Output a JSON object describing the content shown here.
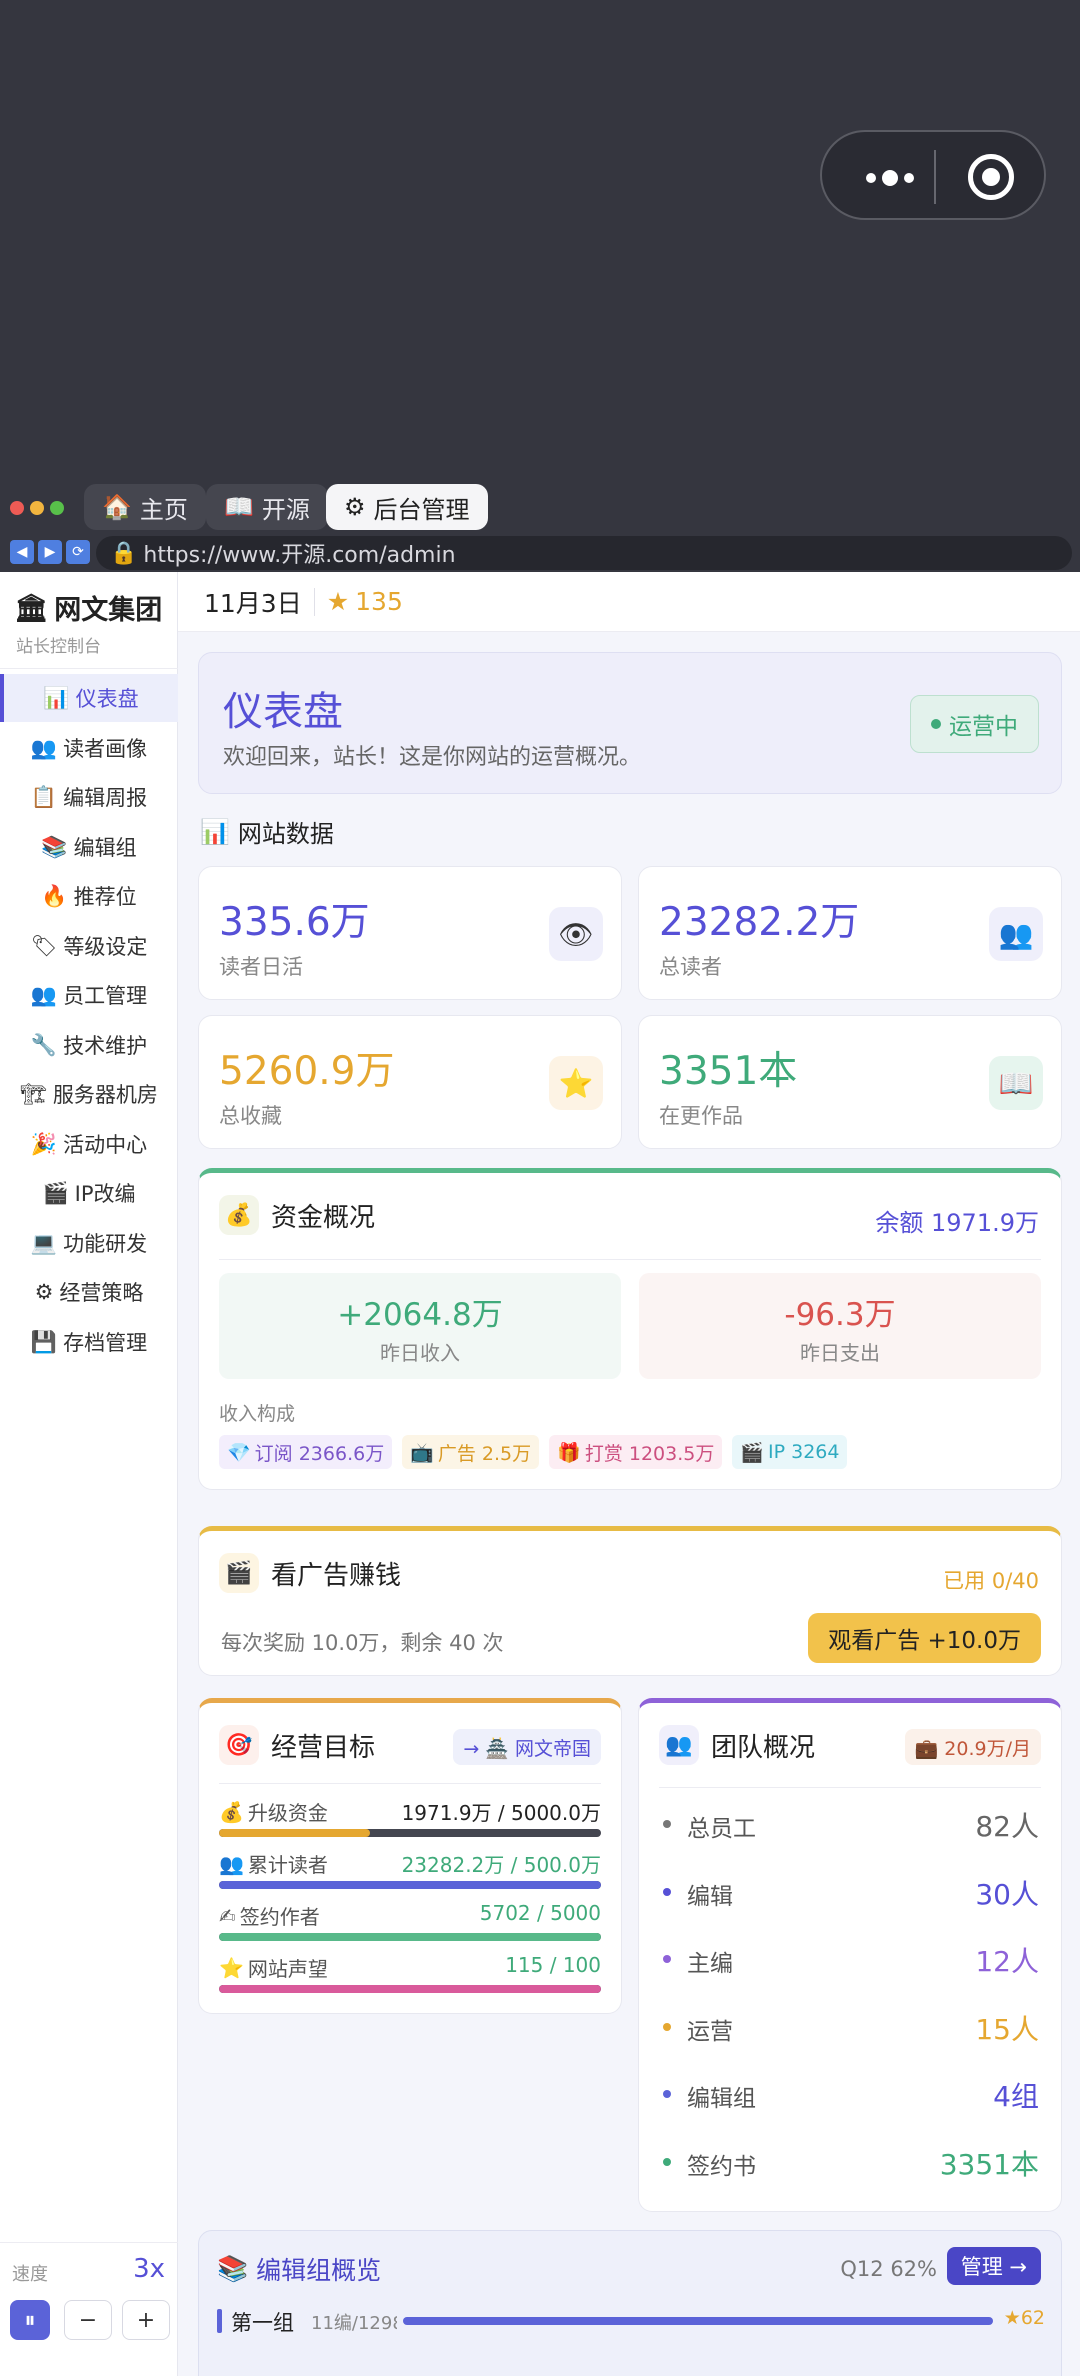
{
  "browser": {
    "tabs": [
      {
        "icon": "🏠",
        "label": "主页"
      },
      {
        "icon": "📖",
        "label": "开源"
      },
      {
        "icon": "⚙",
        "label": "后台管理"
      }
    ],
    "url": "https://www.开源.com/admin"
  },
  "sidebar": {
    "brand": "网文集团",
    "brand_icon": "🏛",
    "subtitle": "站长控制台",
    "items": [
      {
        "icon": "📊",
        "label": "仪表盘"
      },
      {
        "icon": "👥",
        "label": "读者画像"
      },
      {
        "icon": "📋",
        "label": "编辑周报"
      },
      {
        "icon": "📚",
        "label": "编辑组"
      },
      {
        "icon": "🔥",
        "label": "推荐位"
      },
      {
        "icon": "🏷",
        "label": "等级设定"
      },
      {
        "icon": "👥",
        "label": "员工管理"
      },
      {
        "icon": "🔧",
        "label": "技术维护"
      },
      {
        "icon": "🏗",
        "label": "服务器机房"
      },
      {
        "icon": "🎉",
        "label": "活动中心"
      },
      {
        "icon": "🎬",
        "label": "IP改编"
      },
      {
        "icon": "💻",
        "label": "功能研发"
      },
      {
        "icon": "⚙",
        "label": "经营策略"
      },
      {
        "icon": "💾",
        "label": "存档管理"
      }
    ],
    "speed_label": "速度",
    "speed_value": "3x",
    "controls": {
      "pause": "⏸",
      "minus": "−",
      "plus": "+"
    }
  },
  "header": {
    "date": "11月3日",
    "stars": "135"
  },
  "hero": {
    "title": "仪表盘",
    "subtitle": "欢迎回来，站长！这是你网站的运营概况。",
    "status": "运营中"
  },
  "site_data": {
    "title": "网站数据",
    "stats": [
      {
        "value": "335.6万",
        "label": "读者日活",
        "icon": "👁",
        "color": "#5650d6"
      },
      {
        "value": "23282.2万",
        "label": "总读者",
        "icon": "👥",
        "color": "#5650d6"
      },
      {
        "value": "5260.9万",
        "label": "总收藏",
        "icon": "⭐",
        "color": "#e5a730"
      },
      {
        "value": "3351本",
        "label": "在更作品",
        "icon": "📖",
        "color": "#3faa7a"
      }
    ]
  },
  "funds": {
    "title": "资金概况",
    "balance": "余额 1971.9万",
    "income": {
      "value": "+2064.8万",
      "label": "昨日收入"
    },
    "expense": {
      "value": "-96.3万",
      "label": "昨日支出"
    },
    "composition_label": "收入构成",
    "chips": [
      {
        "icon": "💎",
        "label": "订阅 2366.6万",
        "color": "#7a55c8",
        "bg": "#f3eefc"
      },
      {
        "icon": "📺",
        "label": "广告 2.5万",
        "color": "#d99a25",
        "bg": "#fcf5e6"
      },
      {
        "icon": "🎁",
        "label": "打赏 1203.5万",
        "color": "#cc4f7f",
        "bg": "#fcedf3"
      },
      {
        "icon": "🎬",
        "label": "IP 3264",
        "color": "#2eaac0",
        "bg": "#e9f7fa"
      }
    ]
  },
  "ad": {
    "title": "看广告赚钱",
    "used": "已用 0/40",
    "desc": "每次奖励 10.0万，剩余 40 次",
    "button": "观看广告 +10.0万"
  },
  "goals": {
    "title": "经营目标",
    "link": "→ 🏯 网文帝国",
    "items": [
      {
        "icon": "💰",
        "label": "升级资金",
        "value": "1971.9万 / 5000.0万",
        "progress": 0.394,
        "color": "#e5a730",
        "value_color": "#222"
      },
      {
        "icon": "👥",
        "label": "累计读者",
        "value": "23282.2万 / 500.0万",
        "progress": 1.0,
        "color": "#5b63d8",
        "value_color": "#3faa7a"
      },
      {
        "icon": "✍",
        "label": "签约作者",
        "value": "5702 / 5000",
        "progress": 1.0,
        "color": "#58b98a",
        "value_color": "#3faa7a"
      },
      {
        "icon": "⭐",
        "label": "网站声望",
        "value": "115 / 100",
        "progress": 1.0,
        "color": "#d95a9b",
        "value_color": "#3faa7a"
      }
    ]
  },
  "team": {
    "title": "团队概况",
    "cost": "💼 20.9万/月",
    "rows": [
      {
        "label": "总员工",
        "value": "82人",
        "color": "#666666",
        "dot": "#777777"
      },
      {
        "label": "编辑",
        "value": "30人",
        "color": "#5650d6",
        "dot": "#5650d6"
      },
      {
        "label": "主编",
        "value": "12人",
        "color": "#8e62d8",
        "dot": "#8e62d8"
      },
      {
        "label": "运营",
        "value": "15人",
        "color": "#e5a730",
        "dot": "#e5a730"
      },
      {
        "label": "编辑组",
        "value": "4组",
        "color": "#5650d6",
        "dot": "#5b63d8"
      },
      {
        "label": "签约书",
        "value": "3351本",
        "color": "#3faa7a",
        "dot": "#3faa7a"
      }
    ]
  },
  "overview": {
    "title": "编辑组概览",
    "quarter": "Q12 62%",
    "button": "管理 →",
    "groups": [
      {
        "name": "第一组",
        "stats": "11编/1298",
        "score": "★62"
      }
    ]
  }
}
